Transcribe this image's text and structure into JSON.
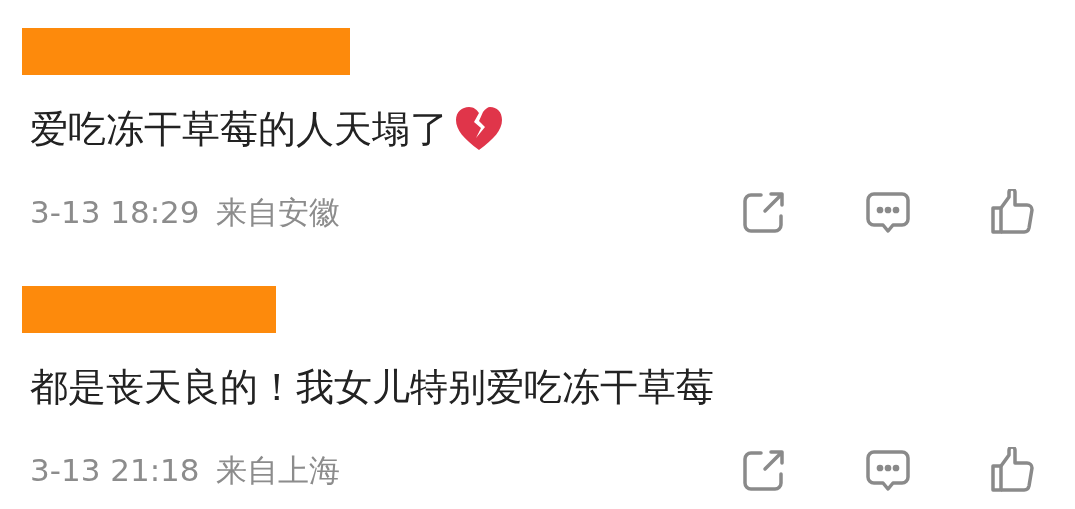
{
  "comments": [
    {
      "text": "爱吃冻干草莓的人天塌了",
      "broken_heart": true,
      "time": "3-13 18:29",
      "location": "来自安徽"
    },
    {
      "text": "都是丧天良的！我女儿特别爱吃冻干草莓",
      "broken_heart": false,
      "time": "3-13 21:18",
      "location": "来自上海"
    }
  ]
}
